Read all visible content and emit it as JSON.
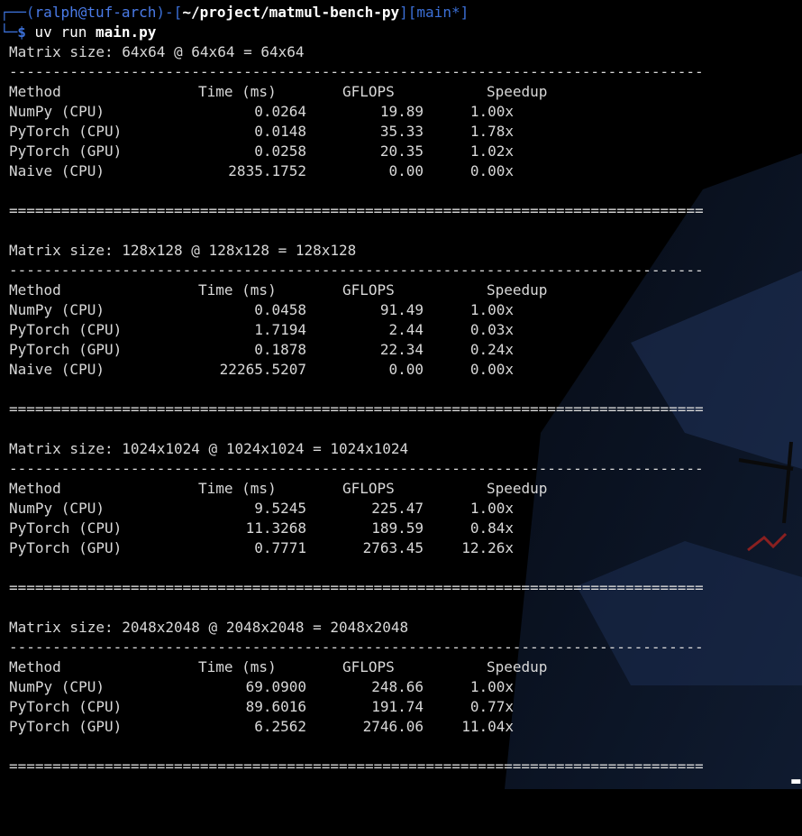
{
  "prompt": {
    "frame_top": "┌──",
    "frame_bottom": "└─",
    "open_paren": "(",
    "user_host": "ralph@tuf-arch",
    "close_paren": ")",
    "dash_bracket_open": "-[",
    "path": "~/project/matmul-bench-py",
    "bracket_mid": "]",
    "branch": "[main*]",
    "dollar": "$",
    "command": "uv run ",
    "command_arg": "main.py"
  },
  "columns": {
    "method": "Method",
    "time": "Time (ms)",
    "gflops": "GFLOPS",
    "speedup": "Speedup"
  },
  "dash_rule": "--------------------------------------------------------------------------------",
  "eq_rule": "================================================================================",
  "sections": [
    {
      "title": "Matrix size: 64x64 @ 64x64 = 64x64",
      "rows": [
        {
          "method": "NumPy (CPU)",
          "time": "0.0264",
          "gflops": "19.89",
          "speedup": "1.00x"
        },
        {
          "method": "PyTorch (CPU)",
          "time": "0.0148",
          "gflops": "35.33",
          "speedup": "1.78x"
        },
        {
          "method": "PyTorch (GPU)",
          "time": "0.0258",
          "gflops": "20.35",
          "speedup": "1.02x"
        },
        {
          "method": "Naive (CPU)",
          "time": "2835.1752",
          "gflops": "0.00",
          "speedup": "0.00x"
        }
      ]
    },
    {
      "title": "Matrix size: 128x128 @ 128x128 = 128x128",
      "rows": [
        {
          "method": "NumPy (CPU)",
          "time": "0.0458",
          "gflops": "91.49",
          "speedup": "1.00x"
        },
        {
          "method": "PyTorch (CPU)",
          "time": "1.7194",
          "gflops": "2.44",
          "speedup": "0.03x"
        },
        {
          "method": "PyTorch (GPU)",
          "time": "0.1878",
          "gflops": "22.34",
          "speedup": "0.24x"
        },
        {
          "method": "Naive (CPU)",
          "time": "22265.5207",
          "gflops": "0.00",
          "speedup": "0.00x"
        }
      ]
    },
    {
      "title": "Matrix size: 1024x1024 @ 1024x1024 = 1024x1024",
      "rows": [
        {
          "method": "NumPy (CPU)",
          "time": "9.5245",
          "gflops": "225.47",
          "speedup": "1.00x"
        },
        {
          "method": "PyTorch (CPU)",
          "time": "11.3268",
          "gflops": "189.59",
          "speedup": "0.84x"
        },
        {
          "method": "PyTorch (GPU)",
          "time": "0.7771",
          "gflops": "2763.45",
          "speedup": "12.26x"
        }
      ]
    },
    {
      "title": "Matrix size: 2048x2048 @ 2048x2048 = 2048x2048",
      "rows": [
        {
          "method": "NumPy (CPU)",
          "time": "69.0900",
          "gflops": "248.66",
          "speedup": "1.00x"
        },
        {
          "method": "PyTorch (CPU)",
          "time": "89.6016",
          "gflops": "191.74",
          "speedup": "0.77x"
        },
        {
          "method": "PyTorch (GPU)",
          "time": "6.2562",
          "gflops": "2746.06",
          "speedup": "11.04x"
        }
      ]
    }
  ],
  "cursor": "▂",
  "colors": {
    "background": "#000000",
    "text": "#d8d8d8",
    "prompt_blue": "#3b6fd6",
    "wallpaper_blue": "#1c2f55"
  }
}
